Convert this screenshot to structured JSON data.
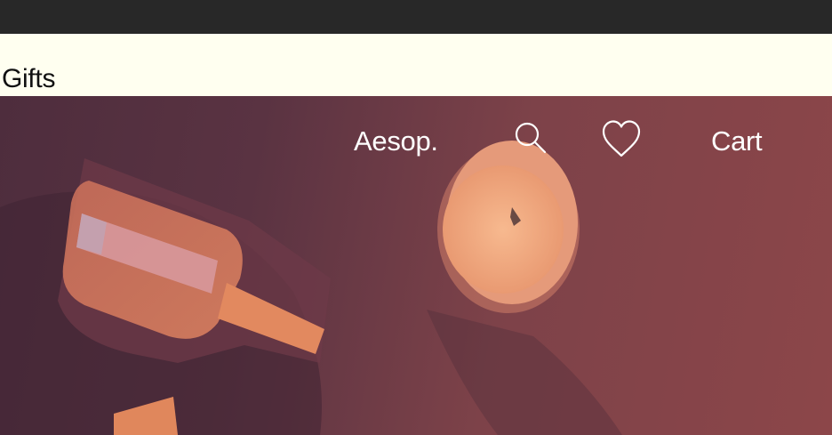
{
  "banner": {
    "label": "Gifts"
  },
  "nav": {
    "logo": "Aesop.",
    "search_icon": "search-icon",
    "wishlist_icon": "heart-icon",
    "cart_label": "Cart"
  },
  "colors": {
    "topbar": "#282828",
    "banner_bg": "#fffff0",
    "hero_base": "#6b3a45",
    "nav_text": "#ffffff"
  }
}
